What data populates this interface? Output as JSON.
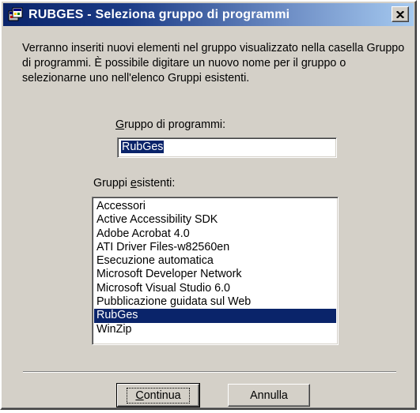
{
  "window": {
    "title": "RUBGES - Seleziona gruppo di programmi",
    "close_glyph": "✕",
    "icon": "program-group-icon"
  },
  "description": "Verranno inseriti nuovi elementi nel gruppo visualizzato nella casella Gruppo di programmi. È possibile digitare un nuovo nome per il gruppo o selezionarne uno nell'elenco Gruppi esistenti.",
  "group_field": {
    "label_mnemonic": "G",
    "label_rest": "ruppo di programmi:",
    "value": "RubGes"
  },
  "existing_groups": {
    "label_pre": "Gruppi ",
    "label_mnemonic": "e",
    "label_post": "sistenti:",
    "items": [
      "Accessori",
      "Active Accessibility SDK",
      "Adobe Acrobat 4.0",
      "ATI Driver Files-w82560en",
      "Esecuzione automatica",
      "Microsoft Developer Network",
      "Microsoft Visual Studio 6.0",
      "Pubblicazione guidata sul Web",
      "RubGes",
      "WinZip"
    ],
    "selected": "RubGes"
  },
  "buttons": {
    "continue_mnemonic": "C",
    "continue_rest": "ontinua",
    "cancel": "Annulla"
  },
  "colors": {
    "title_gradient_start": "#0a246a",
    "title_gradient_end": "#a6caf0",
    "dialog_bg": "#d4d0c8",
    "selection": "#0a246a"
  }
}
